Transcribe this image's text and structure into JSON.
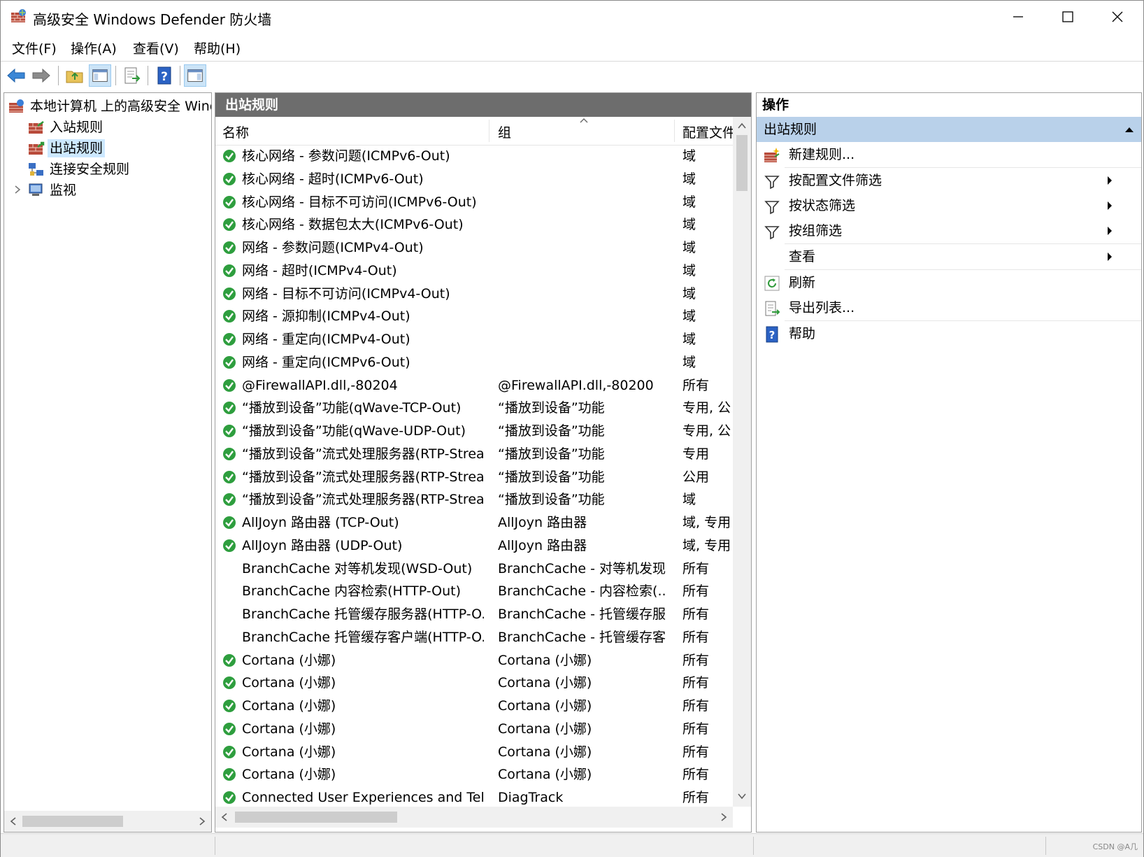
{
  "window": {
    "title": "高级安全 Windows Defender 防火墙"
  },
  "menu": [
    "文件(F)",
    "操作(A)",
    "查看(V)",
    "帮助(H)"
  ],
  "tree": {
    "root": "本地计算机 上的高级安全 Wind",
    "items": [
      "入站规则",
      "出站规则",
      "连接安全规则",
      "监视"
    ]
  },
  "center": {
    "title": "出站规则",
    "columns": {
      "name": "名称",
      "group": "组",
      "profile": "配置文件"
    },
    "rows": [
      {
        "name": "核心网络 - 参数问题(ICMPv6-Out)",
        "group": "",
        "profile": "域",
        "enabled": true
      },
      {
        "name": "核心网络 - 超时(ICMPv6-Out)",
        "group": "",
        "profile": "域",
        "enabled": true
      },
      {
        "name": "核心网络 - 目标不可访问(ICMPv6-Out)",
        "group": "",
        "profile": "域",
        "enabled": true
      },
      {
        "name": "核心网络 - 数据包太大(ICMPv6-Out)",
        "group": "",
        "profile": "域",
        "enabled": true
      },
      {
        "name": "网络 - 参数问题(ICMPv4-Out)",
        "group": "",
        "profile": "域",
        "enabled": true
      },
      {
        "name": "网络 - 超时(ICMPv4-Out)",
        "group": "",
        "profile": "域",
        "enabled": true
      },
      {
        "name": "网络 - 目标不可访问(ICMPv4-Out)",
        "group": "",
        "profile": "域",
        "enabled": true
      },
      {
        "name": "网络 - 源抑制(ICMPv4-Out)",
        "group": "",
        "profile": "域",
        "enabled": true
      },
      {
        "name": "网络 - 重定向(ICMPv4-Out)",
        "group": "",
        "profile": "域",
        "enabled": true
      },
      {
        "name": "网络 - 重定向(ICMPv6-Out)",
        "group": "",
        "profile": "域",
        "enabled": true
      },
      {
        "name": "@FirewallAPI.dll,-80204",
        "group": "@FirewallAPI.dll,-80200",
        "profile": "所有",
        "enabled": true
      },
      {
        "name": "“播放到设备”功能(qWave-TCP-Out)",
        "group": "“播放到设备”功能",
        "profile": "专用, 公",
        "enabled": true
      },
      {
        "name": "“播放到设备”功能(qWave-UDP-Out)",
        "group": "“播放到设备”功能",
        "profile": "专用, 公",
        "enabled": true
      },
      {
        "name": "“播放到设备”流式处理服务器(RTP-Strea...",
        "group": "“播放到设备”功能",
        "profile": "专用",
        "enabled": true
      },
      {
        "name": "“播放到设备”流式处理服务器(RTP-Strea...",
        "group": "“播放到设备”功能",
        "profile": "公用",
        "enabled": true
      },
      {
        "name": "“播放到设备”流式处理服务器(RTP-Strea...",
        "group": "“播放到设备”功能",
        "profile": "域",
        "enabled": true
      },
      {
        "name": "AllJoyn 路由器 (TCP-Out)",
        "group": "AllJoyn 路由器",
        "profile": "域, 专用",
        "enabled": true
      },
      {
        "name": "AllJoyn 路由器 (UDP-Out)",
        "group": "AllJoyn 路由器",
        "profile": "域, 专用",
        "enabled": true
      },
      {
        "name": "BranchCache 对等机发现(WSD-Out)",
        "group": "BranchCache - 对等机发现...",
        "profile": "所有",
        "enabled": false
      },
      {
        "name": "BranchCache 内容检索(HTTP-Out)",
        "group": "BranchCache - 内容检索(...",
        "profile": "所有",
        "enabled": false
      },
      {
        "name": "BranchCache 托管缓存服务器(HTTP-O...",
        "group": "BranchCache - 托管缓存服...",
        "profile": "所有",
        "enabled": false
      },
      {
        "name": "BranchCache 托管缓存客户端(HTTP-O...",
        "group": "BranchCache - 托管缓存客...",
        "profile": "所有",
        "enabled": false
      },
      {
        "name": "Cortana (小娜)",
        "group": "Cortana (小娜)",
        "profile": "所有",
        "enabled": true
      },
      {
        "name": "Cortana (小娜)",
        "group": "Cortana (小娜)",
        "profile": "所有",
        "enabled": true
      },
      {
        "name": "Cortana (小娜)",
        "group": "Cortana (小娜)",
        "profile": "所有",
        "enabled": true
      },
      {
        "name": "Cortana (小娜)",
        "group": "Cortana (小娜)",
        "profile": "所有",
        "enabled": true
      },
      {
        "name": "Cortana (小娜)",
        "group": "Cortana (小娜)",
        "profile": "所有",
        "enabled": true
      },
      {
        "name": "Cortana (小娜)",
        "group": "Cortana (小娜)",
        "profile": "所有",
        "enabled": true
      },
      {
        "name": "Connected User Experiences and Tel...",
        "group": "DiagTrack",
        "profile": "所有",
        "enabled": true
      }
    ]
  },
  "actions": {
    "title": "操作",
    "section": "出站规则",
    "items": [
      {
        "label": "新建规则...",
        "icon": "new-rule-icon",
        "submenu": false
      },
      {
        "label": "按配置文件筛选",
        "icon": "filter-icon",
        "submenu": true
      },
      {
        "label": "按状态筛选",
        "icon": "filter-icon",
        "submenu": true
      },
      {
        "label": "按组筛选",
        "icon": "filter-icon",
        "submenu": true
      },
      {
        "label": "查看",
        "icon": "",
        "submenu": true
      },
      {
        "label": "刷新",
        "icon": "refresh-icon",
        "submenu": false
      },
      {
        "label": "导出列表...",
        "icon": "export-icon",
        "submenu": false
      },
      {
        "label": "帮助",
        "icon": "help-icon",
        "submenu": false
      }
    ]
  },
  "colors": {
    "selection": "#cce8ff",
    "header_bg": "#6d6d6d",
    "action_section": "#b9d1ea",
    "check_green": "#2e9e3e"
  },
  "watermark": "CSDN @A几"
}
